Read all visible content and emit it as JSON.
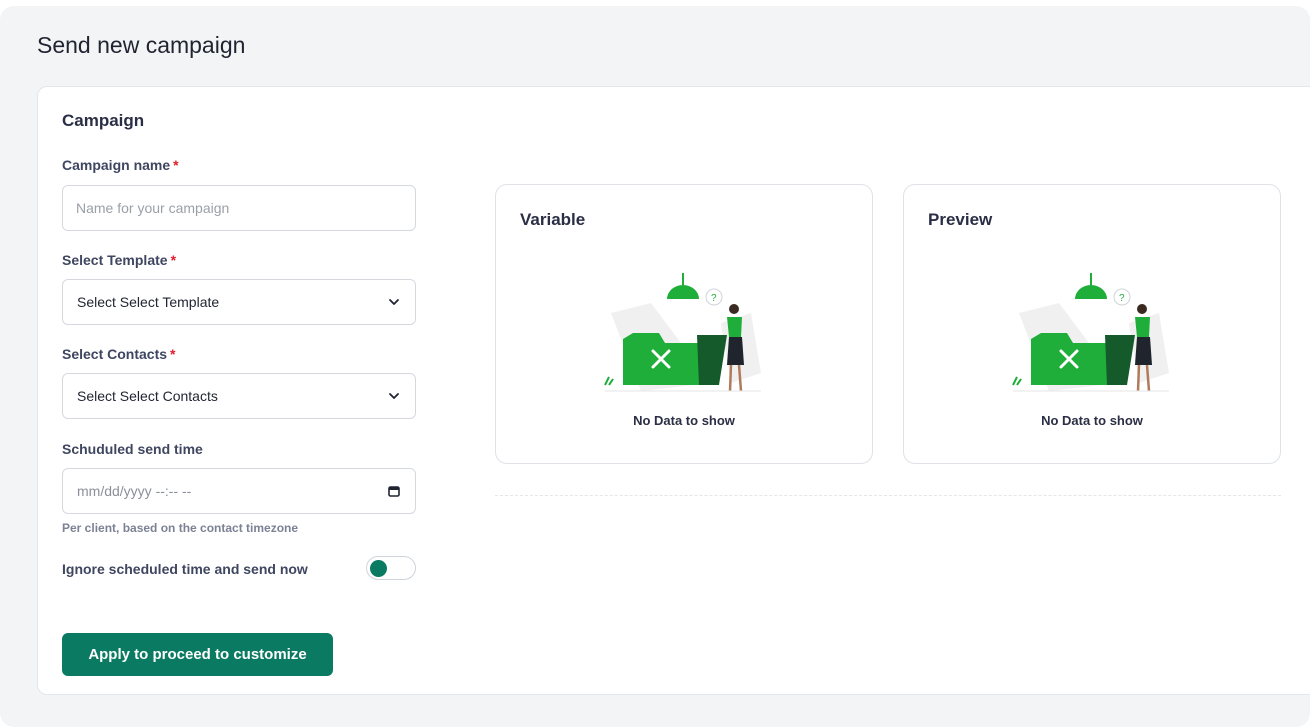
{
  "page": {
    "title": "Send new campaign"
  },
  "campaign": {
    "section_title": "Campaign",
    "required_mark": "*",
    "name_field": {
      "label": "Campaign name",
      "placeholder": "Name for your campaign"
    },
    "template_field": {
      "label": "Select Template",
      "value": "Select Select Template"
    },
    "contacts_field": {
      "label": "Select Contacts",
      "value": "Select Select Contacts"
    },
    "schedule_field": {
      "label": "Schuduled send time",
      "placeholder": "mm/dd/yyyy --:-- --",
      "hint": "Per client, based on the contact timezone"
    },
    "ignore_toggle": {
      "label": "Ignore scheduled time and send now",
      "on": false
    },
    "apply_button": "Apply to proceed to customize"
  },
  "panels": {
    "variable": {
      "title": "Variable",
      "empty_text": "No Data to show"
    },
    "preview": {
      "title": "Preview",
      "empty_text": "No Data to show"
    }
  },
  "colors": {
    "accent": "#0b7a62",
    "illustration_green": "#1fae3a",
    "required": "#e11d2a"
  },
  "icons": {
    "select": "chevron-down-icon",
    "date": "calendar-icon",
    "empty": "empty-folder-illustration"
  }
}
